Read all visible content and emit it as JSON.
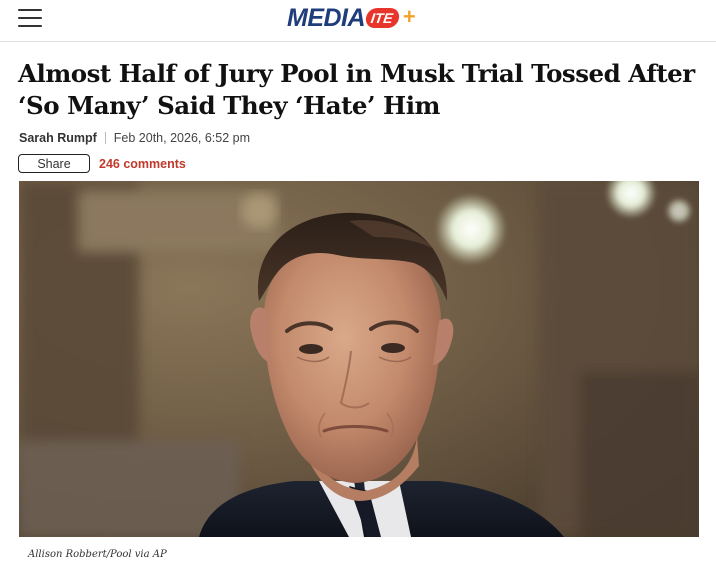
{
  "header": {
    "menu_icon": "hamburger-menu-icon",
    "logo": {
      "word": "MEDIA",
      "badge": "ITE",
      "plus": "+",
      "colors": {
        "word": "#1f3d7a",
        "badge": "#e8352b",
        "plus": "#f2a32a"
      }
    }
  },
  "article": {
    "headline": "Almost Half of Jury Pool in Musk Trial Tossed After ‘So Many’ Said They ‘Hate’ Him",
    "author": "Sarah Rumpf",
    "date": "Feb 20th, 2026, 6:52 pm",
    "share_label": "Share",
    "comments_label": "246 comments",
    "accent_color": "#c0392b"
  },
  "image": {
    "caption": "Allison Robbert/Pool via AP"
  }
}
